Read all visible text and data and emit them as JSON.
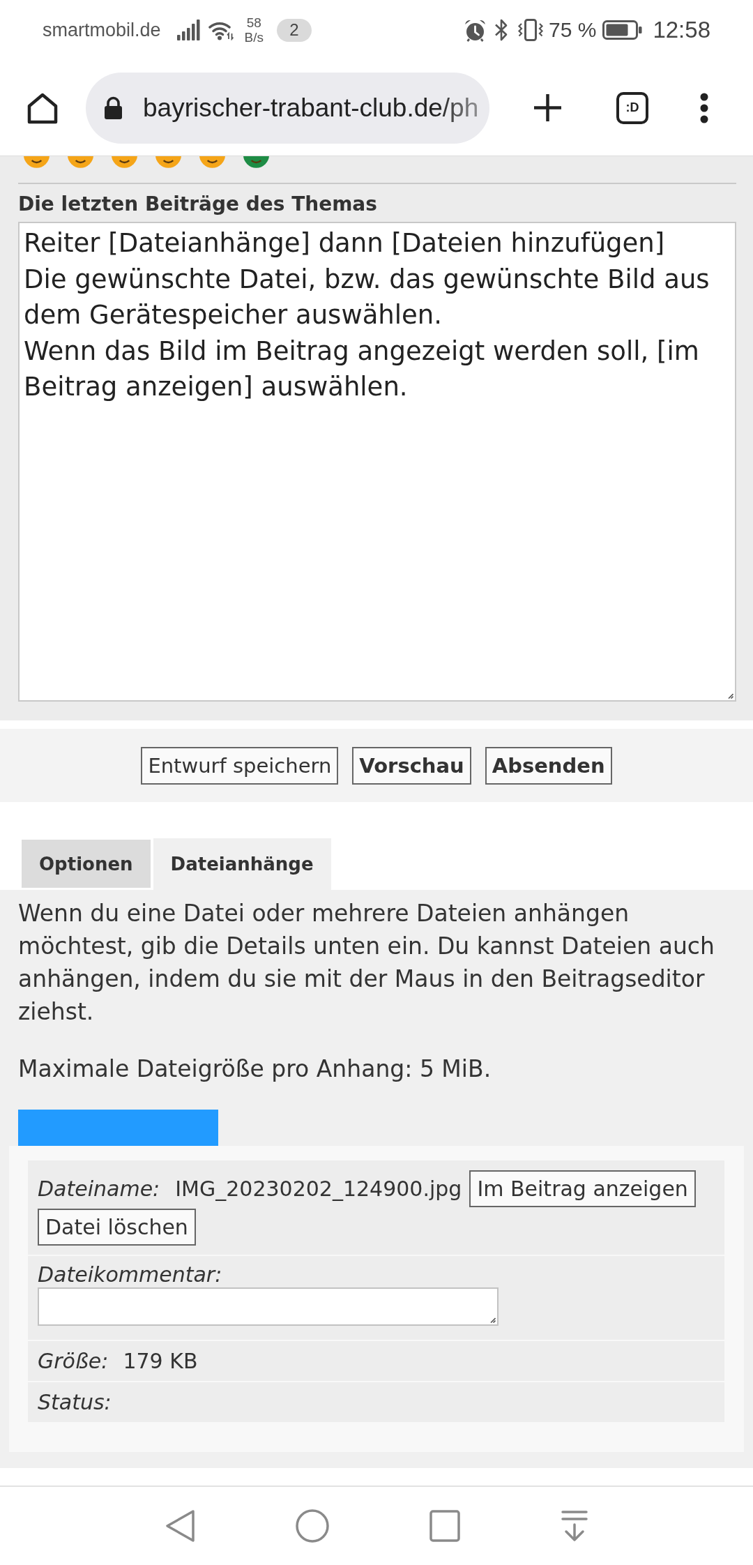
{
  "status_bar": {
    "carrier": "smartmobil.de",
    "speed_value": "58",
    "speed_unit": "B/s",
    "notification_count": "2",
    "battery_percent": "75 %",
    "time": "12:58"
  },
  "browser_toolbar": {
    "url": "bayrischer-trabant-club.de/ph",
    "tab_counter": ":D"
  },
  "smileys": [
    {
      "color": "#f5a518"
    },
    {
      "color": "#f5a518"
    },
    {
      "color": "#f5a518"
    },
    {
      "color": "#f5a518"
    },
    {
      "color": "#f5a518"
    },
    {
      "color": "#1e8c45"
    }
  ],
  "topic_review": {
    "heading": "Die letzten Beiträge des Themas",
    "message": "Reiter [Dateianhänge] dann [Dateien hinzufügen]\nDie gewünschte Datei, bzw. das gewünschte Bild aus dem Gerätespeicher auswählen.\nWenn das Bild im Beitrag angezeigt werden soll, [im Beitrag anzeigen] auswählen."
  },
  "form_buttons": [
    {
      "label": "Entwurf speichern",
      "primary": false
    },
    {
      "label": "Vorschau",
      "primary": true
    },
    {
      "label": "Absenden",
      "primary": true
    }
  ],
  "tabs": [
    {
      "label": "Optionen",
      "selected": false
    },
    {
      "label": "Dateianhänge",
      "selected": true
    }
  ],
  "attachment_panel": {
    "intro": "Wenn du eine Datei oder mehrere Dateien anhängen möchtest, gib die Details unten ein. Du kannst Dateien auch anhängen, indem du sie mit der Maus in den Beitragseditor ziehst.",
    "max_size": "Maximale Dateigröße pro Anhang: 5 MiB.",
    "file_name_row": {
      "label": "Dateiname:",
      "value": "IMG_20230202_124900.jpg",
      "buttons": [
        "Im Beitrag anzeigen",
        "Datei löschen"
      ]
    },
    "comment_row": {
      "label": "Dateikommentar:"
    },
    "size_row": {
      "label": "Größe:",
      "value": "179 KB"
    },
    "status_row": {
      "label": "Status:"
    }
  }
}
